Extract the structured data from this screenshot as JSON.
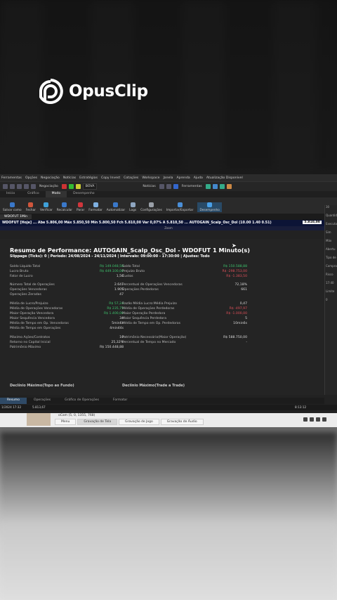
{
  "branding": {
    "logo_text": "OpusClip"
  },
  "menu": [
    "Ferramentas",
    "Opções",
    "Negociação",
    "Notícias",
    "Estratégias",
    "Copy Invest",
    "Cotações",
    "Workspace",
    "Janela",
    "Aprenda",
    "Ajuda",
    "Atualização Disponível"
  ],
  "toolbar": {
    "negociacao_label": "Negociação",
    "asset_select": "BOVA",
    "noticias": "Notícias",
    "ferramentas": "Ferramentas"
  },
  "top_tabs": [
    {
      "label": "Início"
    },
    {
      "label": "Gráfico"
    },
    {
      "label": "Modo",
      "active": true
    },
    {
      "label": "Desempenho"
    }
  ],
  "ribbon": [
    {
      "label": "Salvar como",
      "color": "#3a78c9"
    },
    {
      "label": "Fechar",
      "color": "#d0563c"
    },
    {
      "label": "Verificar",
      "color": "#3fa0d8"
    },
    {
      "label": "Recalcular",
      "color": "#3a78c9"
    },
    {
      "label": "Parar",
      "color": "#d0363c"
    },
    {
      "label": "Formatar",
      "color": "#7fb0e0"
    },
    {
      "label": "Automatizar",
      "color": "#3a78c9"
    },
    {
      "label": "Logs",
      "color": "#8fa6c0"
    },
    {
      "label": "Configurações",
      "color": "#9aa0a8"
    },
    {
      "label": "Importar/Exportar",
      "color": "#4a8fd8"
    },
    {
      "label": "Desempenho",
      "color": "#4aa0e8",
      "highlight": true
    }
  ],
  "doc_tab": "WDOFUT 1Min",
  "ticker": {
    "text": "WDOFUT [Hoje] ... Abe 5.806,00 Máx 5.850,50 Mín 5.800,50 Fch 5.810,00 Var 0,07% A 5.810,50 ... AUTOGAIN_Scalp_Osc_Dol (10.00 1.40 0.51)",
    "price": "5.810,00",
    "sub": "Zoom"
  },
  "report": {
    "title": "Resumo de Performance: AUTOGAIN_Scalp_Osc_Dol - WDOFUT 1 Minuto(s)",
    "subtitle": "Slippage (Ticks): 0 | Período: 24/08/2024 - 24/11/2024 | Intervalo: 09:00:00 - 17:30:00 | Ajustes: Todo",
    "left": [
      {
        "label": "Saldo Líquido Total",
        "value": "R$ 149.048,58",
        "tone": "pos"
      },
      {
        "label": "Lucro Bruto",
        "value": "R$ 449.100,00",
        "tone": "pos"
      },
      {
        "label": "Fator de Lucro",
        "value": "1,50",
        "tone": "wht"
      },
      {
        "label": "Número Total de Operações",
        "value": "2.641",
        "tone": "wht"
      },
      {
        "label": "Operações Vencedoras",
        "value": "1.905",
        "tone": "wht"
      },
      {
        "label": "Operações Zeradas",
        "value": "47",
        "tone": "wht"
      },
      {
        "label": "Média de Lucro/Prejuízo",
        "value": "R$ 57,24",
        "tone": "pos"
      },
      {
        "label": "Média de Operações Vencedoras",
        "value": "R$ 235,75",
        "tone": "pos"
      },
      {
        "label": "Maior Operação Vencedora",
        "value": "R$ 1.400,00",
        "tone": "pos"
      },
      {
        "label": "Maior Sequência Vencedora",
        "value": "34",
        "tone": "wht"
      },
      {
        "label": "Média de Tempo em Op. Vencedoras",
        "value": "5min6s",
        "tone": "wht"
      },
      {
        "label": "Média de Tempo em Operações",
        "value": "4min44s",
        "tone": "wht"
      },
      {
        "label": "Máximo Ações/Contratos",
        "value": "10",
        "tone": "wht"
      },
      {
        "label": "Retorno no Capital Inicial",
        "value": "25,32%",
        "tone": "wht"
      },
      {
        "label": "Patrimônio Máximo",
        "value": "R$ 150.448,88",
        "tone": "wht"
      }
    ],
    "right": [
      {
        "label": "Saldo Total",
        "value": "R$ 150.588,88",
        "tone": "pos"
      },
      {
        "label": "Prejuízo Bruto",
        "value": "R$ -298.753,00",
        "tone": "neg"
      },
      {
        "label": "Custos",
        "value": "R$ -1.383,50",
        "tone": "neg"
      },
      {
        "label": "Percentual de Operações Vencedoras",
        "value": "72,18%",
        "tone": "wht"
      },
      {
        "label": "Operações Perdedoras",
        "value": "661",
        "tone": "wht"
      },
      {
        "label": "Razão Média Lucro:Média Prejuízo",
        "value": "0,47",
        "tone": "wht"
      },
      {
        "label": "Média de Operações Perdedoras",
        "value": "R$ -497,97",
        "tone": "neg"
      },
      {
        "label": "Maior Operação Perdedora",
        "value": "R$ -1.000,00",
        "tone": "neg"
      },
      {
        "label": "Maior Sequência Perdedora",
        "value": "5",
        "tone": "wht"
      },
      {
        "label": "Média de Tempo em Op. Perdedoras",
        "value": "10min6s",
        "tone": "wht"
      },
      {
        "label": "Patrimônio Necessário(Maior Operação)",
        "value": "R$ 588.750,00",
        "tone": "wht"
      },
      {
        "label": "Percentual de Tempo no Mercado",
        "value": "-",
        "tone": "wht"
      }
    ],
    "section_left": "Declínio Máximo(Topo ao Fundo)",
    "section_right": "Declínio Máximo(Trade a Trade)"
  },
  "bottom_tabs": [
    {
      "label": "Resumo",
      "active": true
    },
    {
      "label": "Operações"
    },
    {
      "label": "Gráfico de Operações"
    },
    {
      "label": "Formatar"
    }
  ],
  "status": {
    "datetime": "1/2024 17:32",
    "price": "5.813,67",
    "clock": "8:13:12"
  },
  "recorder": {
    "title": "oCam (5, 0, 1355, 768)",
    "tabs": [
      "Menu",
      "Gravação de Tela",
      "Gravação de Jogo",
      "Gravação de Áudio"
    ],
    "active_tab": 1
  },
  "right_panel": [
    "30",
    "Quantid",
    "Executa",
    "Sim",
    "Máx",
    "Abertu",
    "Tipo de",
    "Compra",
    "Risco",
    "17:40",
    "Limite",
    "0"
  ]
}
